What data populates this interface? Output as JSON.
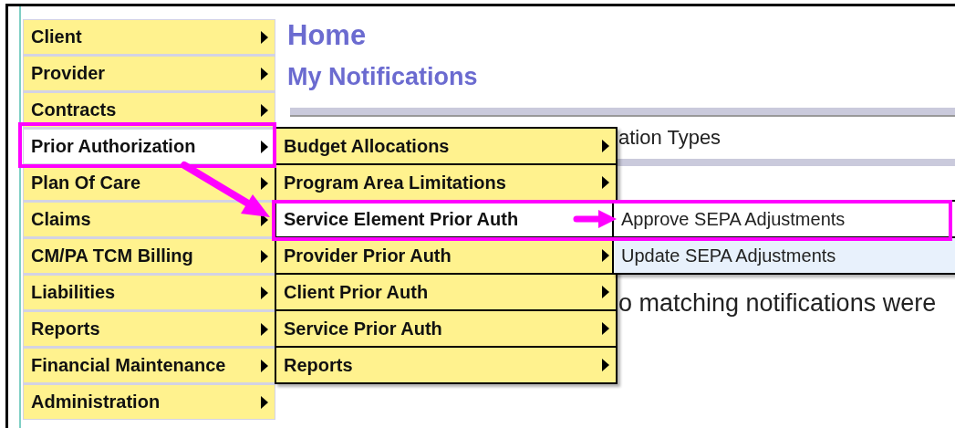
{
  "page": {
    "title": "Home",
    "subtitle": "My Notifications"
  },
  "notifications": {
    "row": "ation Types",
    "message": "o matching notifications were"
  },
  "menu": [
    {
      "label": "Client",
      "selected": false,
      "submenu": true
    },
    {
      "label": "Provider",
      "selected": false,
      "submenu": true
    },
    {
      "label": "Contracts",
      "selected": false,
      "submenu": true
    },
    {
      "label": "Prior Authorization",
      "selected": true,
      "submenu": true,
      "children": [
        {
          "label": "Budget Allocations",
          "selected": false,
          "submenu": true
        },
        {
          "label": "Program Area Limitations",
          "selected": false,
          "submenu": true
        },
        {
          "label": "Service Element Prior Auth",
          "selected": true,
          "submenu": false,
          "children": [
            {
              "label": "Approve SEPA Adjustments",
              "selected": true,
              "submenu": false
            },
            {
              "label": "Update SEPA Adjustments",
              "selected": false,
              "submenu": false
            }
          ]
        },
        {
          "label": "Provider Prior Auth",
          "selected": false,
          "submenu": true
        },
        {
          "label": "Client Prior Auth",
          "selected": false,
          "submenu": true
        },
        {
          "label": "Service Prior Auth",
          "selected": false,
          "submenu": true
        },
        {
          "label": "Reports",
          "selected": false,
          "submenu": true
        }
      ]
    },
    {
      "label": "Plan Of Care",
      "selected": false,
      "submenu": true
    },
    {
      "label": "Claims",
      "selected": false,
      "submenu": true
    },
    {
      "label": "CM/PA TCM Billing",
      "selected": false,
      "submenu": true
    },
    {
      "label": "Liabilities",
      "selected": false,
      "submenu": true
    },
    {
      "label": "Reports",
      "selected": false,
      "submenu": true
    },
    {
      "label": "Financial Maintenance",
      "selected": false,
      "submenu": true
    },
    {
      "label": "Administration",
      "selected": false,
      "submenu": true
    }
  ]
}
